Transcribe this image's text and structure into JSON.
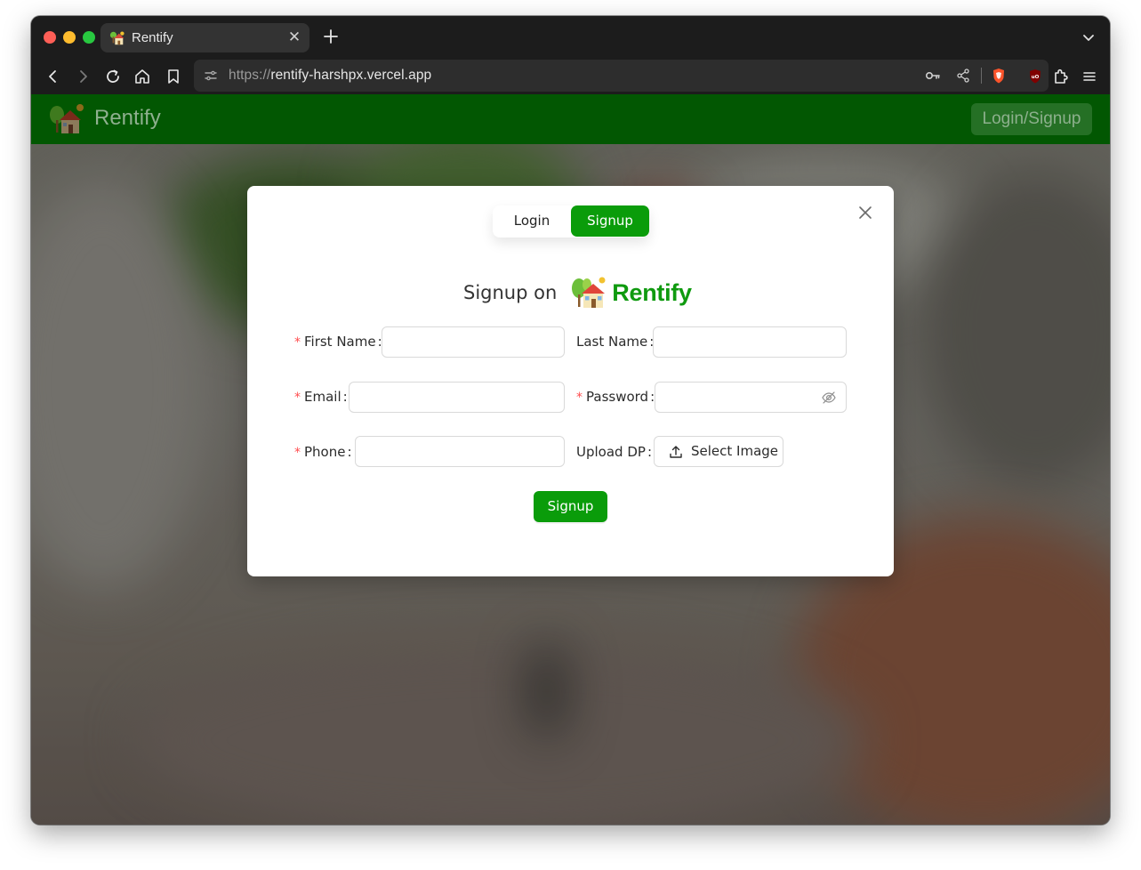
{
  "browser": {
    "tab": {
      "title": "Rentify",
      "favicon": "house-emoji-icon",
      "close_icon": "close-icon"
    },
    "new_tab_icon": "plus-icon",
    "tab_list_icon": "chevron-down-icon",
    "toolbar": {
      "back_icon": "back-arrow-icon",
      "forward_icon": "forward-arrow-icon",
      "reload_icon": "reload-icon",
      "home_icon": "home-icon",
      "bookmark_icon": "bookmark-icon"
    },
    "url": {
      "scheme": "https://",
      "host": "rentify-harshpx.vercel.app"
    },
    "extensions": [
      "key-icon",
      "share-icon",
      "brave-shields-icon",
      "ublock-icon",
      "extensions-puzzle-icon",
      "menu-icon"
    ]
  },
  "navbar": {
    "brand": "Rentify",
    "login_button": "Login/Signup"
  },
  "modal": {
    "tabs": [
      {
        "label": "Login",
        "active": false
      },
      {
        "label": "Signup",
        "active": true
      }
    ],
    "heading": {
      "prefix": "Signup on",
      "brand": "Rentify"
    },
    "fields": {
      "first_name": {
        "label": "First Name",
        "required": true,
        "value": "",
        "placeholder": ""
      },
      "last_name": {
        "label": "Last Name",
        "required": false,
        "value": "",
        "placeholder": ""
      },
      "email": {
        "label": "Email",
        "required": true,
        "value": "",
        "placeholder": ""
      },
      "password": {
        "label": "Password",
        "required": true,
        "value": "",
        "placeholder": ""
      },
      "phone": {
        "label": "Phone",
        "required": true,
        "value": "",
        "placeholder": ""
      },
      "upload_dp": {
        "label": "Upload DP",
        "required": false,
        "button": "Select Image"
      }
    },
    "submit": "Signup"
  },
  "colors": {
    "navbar": "#025702",
    "accent": "#0a9c0a",
    "required": "#ff4d4f"
  }
}
